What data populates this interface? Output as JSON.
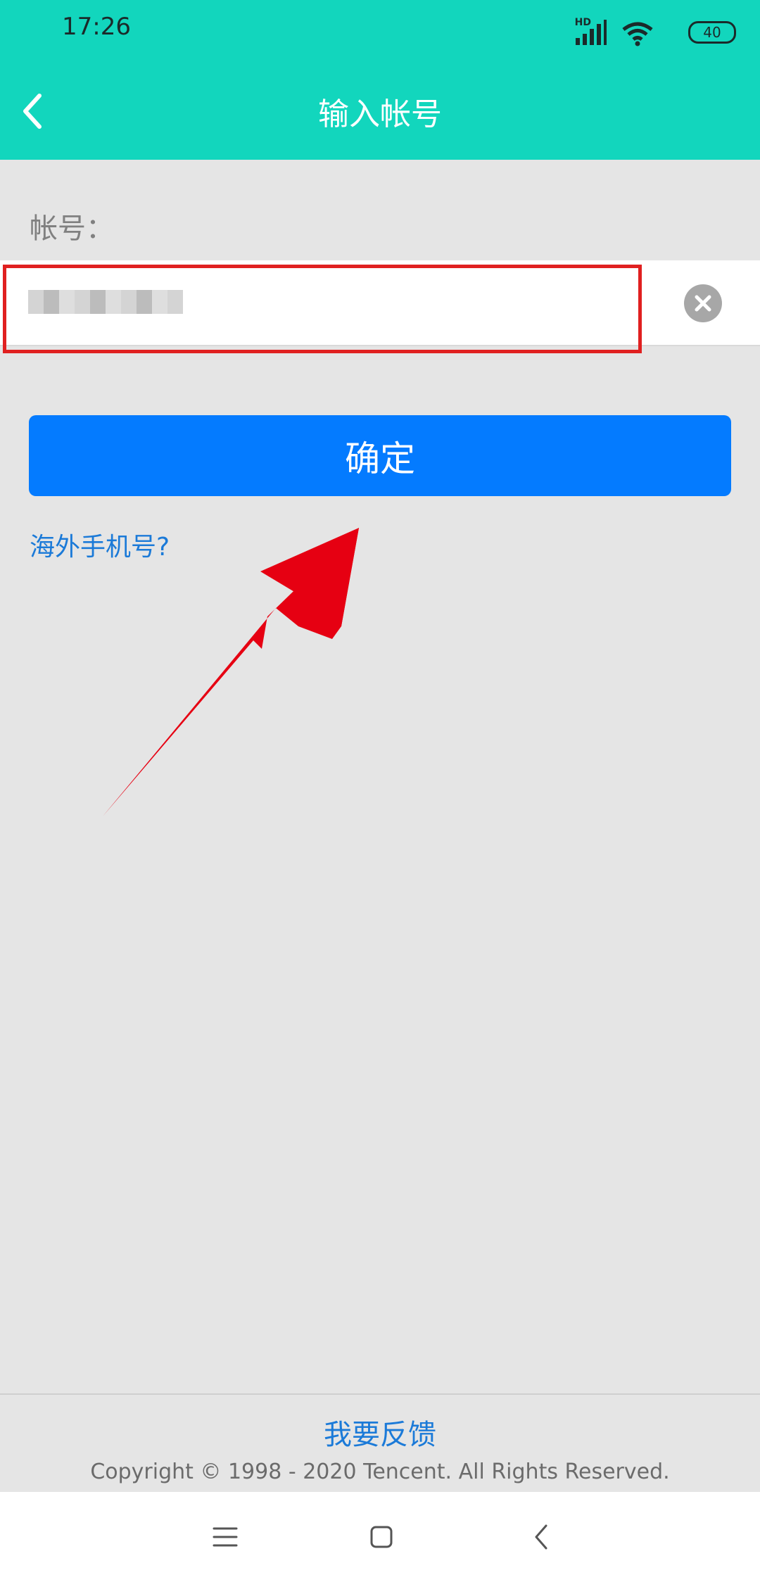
{
  "status_bar": {
    "time": "17:26",
    "network_badge": "HD",
    "battery_level": "40"
  },
  "header": {
    "title": "输入帐号",
    "background_color": "#12d6bd",
    "back_icon": "chevron-left-icon"
  },
  "form": {
    "account_label": "帐号：",
    "account_value": "",
    "clear_icon": "clear-icon",
    "confirm_label": "确定",
    "confirm_color": "#047bff",
    "overseas_link": "海外手机号?"
  },
  "footer": {
    "feedback_link": "我要反馈",
    "copyright": "Copyright © 1998 - 2020 Tencent. All Rights Reserved."
  },
  "navigation": {
    "menu_icon": "menu-icon",
    "home_icon": "home-square-icon",
    "back_icon": "back-chevron-icon"
  }
}
